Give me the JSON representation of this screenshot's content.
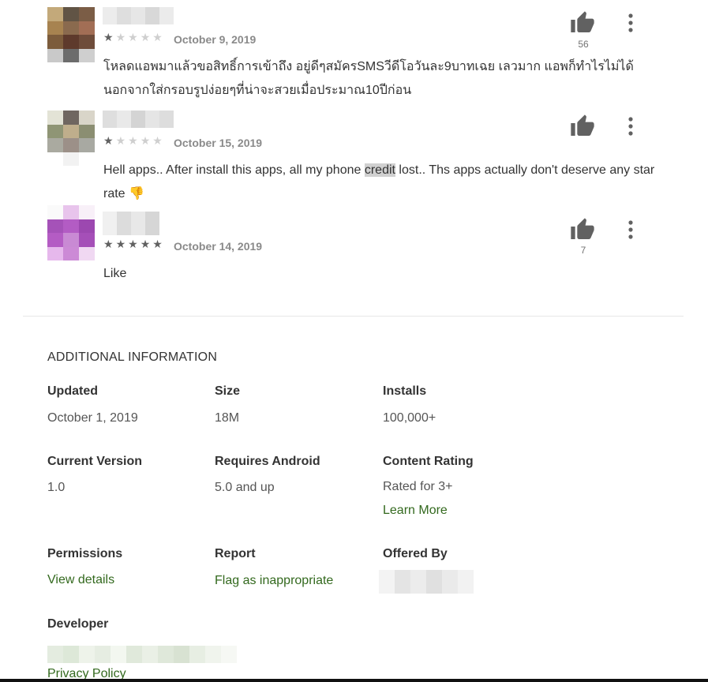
{
  "reviews": [
    {
      "rating": 1,
      "date": "October 9, 2019",
      "text": "โหลดแอพมาแล้วขอสิทธิ์การเข้าถึง อยู่ดีๆสมัครSMSวีดีโอวันละ9บาทเฉย เลวมาก แอพก็ทำไรไม่ได้นอกจากใส่กรอบรูปง่อยๆที่น่าจะสวยเมื่อประมาณ10ปีก่อน",
      "helpful_count": "56",
      "avatar_colors": [
        "#c3a97a",
        "#615445",
        "#7b5d46",
        "#a78350",
        "#8a6a4e",
        "#a26e55",
        "#7c5c3c",
        "#5e3a2c",
        "#6e4c3a",
        "#c9c9c9",
        "#6c6c6c",
        "#cfcfcf"
      ],
      "name_colors": [
        "#ececec",
        "#dedede",
        "#e6e6e6",
        "#d8d8d8",
        "#ebebeb"
      ]
    },
    {
      "rating": 1,
      "date": "October 15, 2019",
      "text_before": "Hell apps.. After install this apps, all my phone ",
      "text_highlight": "credit",
      "text_after": " lost.. Ths apps actually don't deserve any star rate 👎",
      "helpful_count": "",
      "avatar_colors": [
        "#e3e3d6",
        "#6f6660",
        "#d9d5c9",
        "#8f9575",
        "#bfae8c",
        "#8b8e72",
        "#aaaaa0",
        "#9c9088",
        "#a8a9a2",
        "#ffffff",
        "#f2f2f2",
        "#ffffff"
      ],
      "name_colors": [
        "#dedede",
        "#e9e9e9",
        "#d4d4d4",
        "#e5e5e5",
        "#dddddd"
      ]
    },
    {
      "rating": 5,
      "date": "October 14, 2019",
      "text": "Like",
      "helpful_count": "7",
      "avatar_colors": [
        "#fafafa",
        "#e8c4ec",
        "#f8f0f8",
        "#a552b8",
        "#b35cc4",
        "#9c48b0",
        "#b45cc4",
        "#c98ad4",
        "#a54fb8",
        "#e6b8ec",
        "#cc8ad6",
        "#f0d8f2"
      ],
      "name_colors": [
        "#f0f0f0",
        "#dcdcdc",
        "#e8e8e8",
        "#d6d6d6",
        "#ffffff"
      ]
    }
  ],
  "additional_info": {
    "title": "ADDITIONAL INFORMATION",
    "updated_label": "Updated",
    "updated_value": "October 1, 2019",
    "size_label": "Size",
    "size_value": "18M",
    "installs_label": "Installs",
    "installs_value": "100,000+",
    "version_label": "Current Version",
    "version_value": "1.0",
    "android_label": "Requires Android",
    "android_value": "5.0 and up",
    "rating_label": "Content Rating",
    "rating_value": "Rated for 3+",
    "learn_more": "Learn More",
    "permissions_label": "Permissions",
    "permissions_link": "View details",
    "report_label": "Report",
    "report_link": "Flag as inappropriate",
    "offered_label": "Offered By",
    "developer_label": "Developer",
    "privacy_link": "Privacy Policy"
  },
  "colors": {
    "link": "#33691e",
    "star_on": "#616161",
    "star_off": "#cfcfcf"
  }
}
